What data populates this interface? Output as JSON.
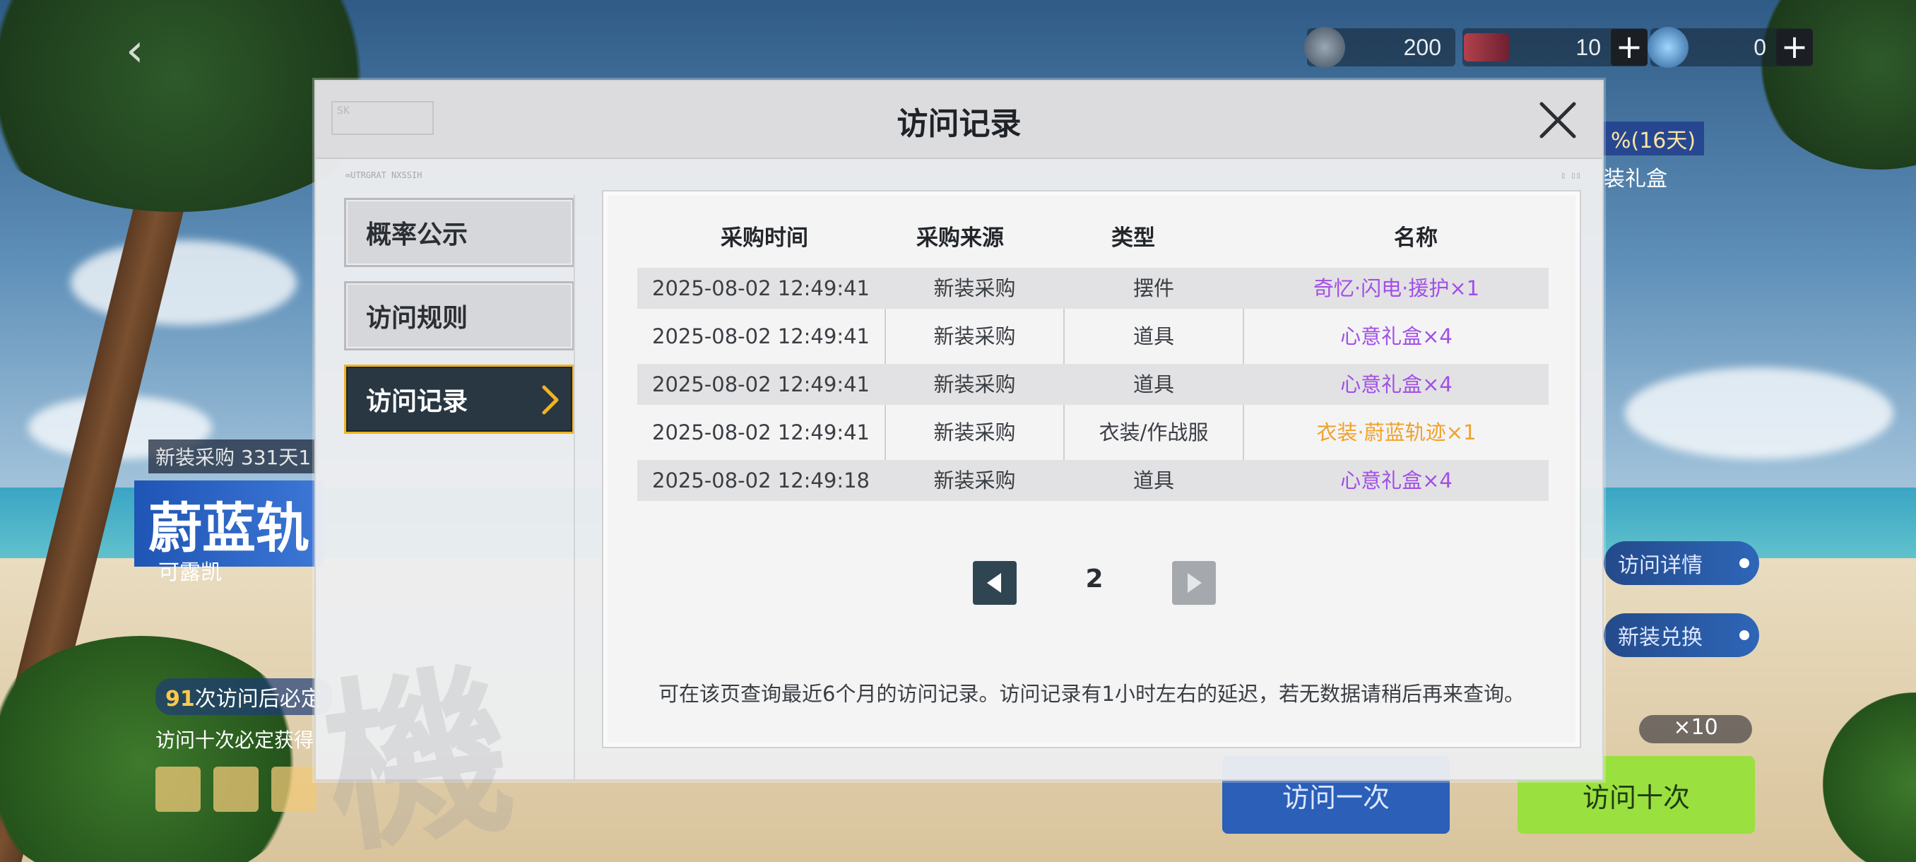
{
  "top_bar": {
    "currencies": [
      {
        "icon": "token-coin-icon",
        "value": "200"
      },
      {
        "icon": "ticket-icon",
        "value": "10"
      },
      {
        "icon": "gem-icon",
        "value": "0"
      }
    ]
  },
  "background": {
    "left": {
      "tag": "新装采购 331天1",
      "title": "蔚蓝轨",
      "subtitle": "可露凯",
      "count_num": "91",
      "count_text": "次访问后必定",
      "note": "访问十次必定获得"
    },
    "right": {
      "promo_top": "%(16天)",
      "promo_sub": "装礼盒",
      "chips": [
        "访问详情",
        "新装兑换"
      ],
      "multiplier": "×10",
      "btn_once": "访问一次",
      "btn_ten": "访问十次"
    }
  },
  "modal": {
    "title": "访问记录",
    "menu": [
      {
        "label": "概率公示",
        "active": false
      },
      {
        "label": "访问规则",
        "active": false
      },
      {
        "label": "访问记录",
        "active": true
      }
    ],
    "columns": [
      "采购时间",
      "采购来源",
      "类型",
      "名称"
    ],
    "records": [
      {
        "time": "2025-08-02 12:49:41",
        "source": "新装采购",
        "type": "摆件",
        "name": "奇忆·闪电·援护×1",
        "rarity": "purple"
      },
      {
        "time": "2025-08-02 12:49:41",
        "source": "新装采购",
        "type": "道具",
        "name": "心意礼盒×4",
        "rarity": "purple"
      },
      {
        "time": "2025-08-02 12:49:41",
        "source": "新装采购",
        "type": "道具",
        "name": "心意礼盒×4",
        "rarity": "purple"
      },
      {
        "time": "2025-08-02 12:49:41",
        "source": "新装采购",
        "type": "衣装/作战服",
        "name": "衣装·蔚蓝轨迹×1",
        "rarity": "orange"
      },
      {
        "time": "2025-08-02 12:49:18",
        "source": "新装采购",
        "type": "道具",
        "name": "心意礼盒×4",
        "rarity": "purple"
      }
    ],
    "page": "2",
    "note": "可在该页查询最近6个月的访问记录。访问记录有1小时左右的延迟，若无数据请稍后再来查询。",
    "watermark": "機",
    "colors": {
      "accent": "#f0b321",
      "active_bg": "#283742",
      "purple": "#a24ee8",
      "orange": "#f0a22a"
    }
  }
}
